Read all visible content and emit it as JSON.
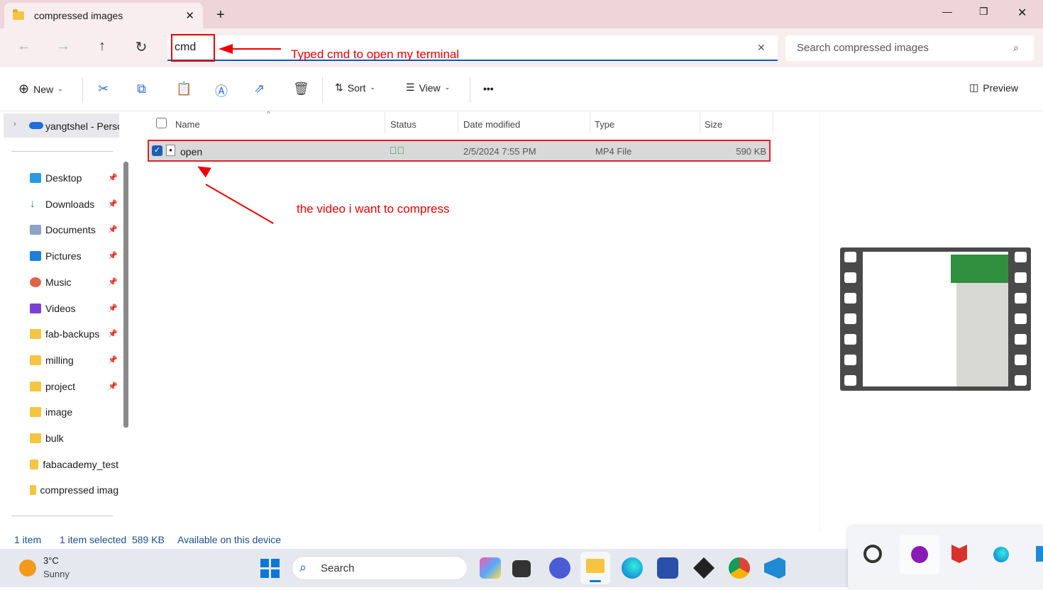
{
  "window": {
    "tab_title": "compressed images",
    "new_tab": "+",
    "minimize": "—",
    "maximize": "❐",
    "close": "✕"
  },
  "nav": {
    "back": "←",
    "forward": "→",
    "up": "↑",
    "refresh": "↻",
    "address_value": "cmd",
    "clear": "✕",
    "search_placeholder": "Search compressed images"
  },
  "annotations": {
    "address_note": "Typed cmd to open my terminal",
    "file_note": "the video i want to compress",
    "color": "#e00000"
  },
  "toolbar": {
    "new": "New",
    "sort": "Sort",
    "view": "View",
    "more": "•••",
    "preview": "Preview"
  },
  "sidebar": {
    "root": "yangtshel - Perso",
    "items": [
      {
        "label": "Desktop",
        "icon": "desktop-icon",
        "pinned": true
      },
      {
        "label": "Downloads",
        "icon": "download-icon",
        "pinned": true
      },
      {
        "label": "Documents",
        "icon": "documents-icon",
        "pinned": true
      },
      {
        "label": "Pictures",
        "icon": "pictures-icon",
        "pinned": true
      },
      {
        "label": "Music",
        "icon": "music-icon",
        "pinned": true
      },
      {
        "label": "Videos",
        "icon": "videos-icon",
        "pinned": true
      },
      {
        "label": "fab-backups",
        "icon": "folder-icon",
        "pinned": true
      },
      {
        "label": "milling",
        "icon": "folder-icon",
        "pinned": true
      },
      {
        "label": "project",
        "icon": "folder-icon",
        "pinned": true
      },
      {
        "label": "image",
        "icon": "folder-icon",
        "pinned": false
      },
      {
        "label": "bulk",
        "icon": "folder-icon",
        "pinned": false
      },
      {
        "label": "fabacademy_test",
        "icon": "folder-icon",
        "pinned": false
      },
      {
        "label": "compressed imag",
        "icon": "folder-icon",
        "pinned": false
      }
    ]
  },
  "columns": {
    "name": "Name",
    "status": "Status",
    "date": "Date modified",
    "type": "Type",
    "size": "Size"
  },
  "files": [
    {
      "name": "open",
      "date": "2/5/2024 7:55 PM",
      "type": "MP4 File",
      "size": "590 KB",
      "selected": true,
      "status": "synced"
    }
  ],
  "status": {
    "count": "1 item",
    "selected": "1 item selected  589 KB",
    "availability": "Available on this device"
  },
  "taskbar": {
    "weather_temp": "3°C",
    "weather_desc": "Sunny",
    "search": "Search"
  }
}
